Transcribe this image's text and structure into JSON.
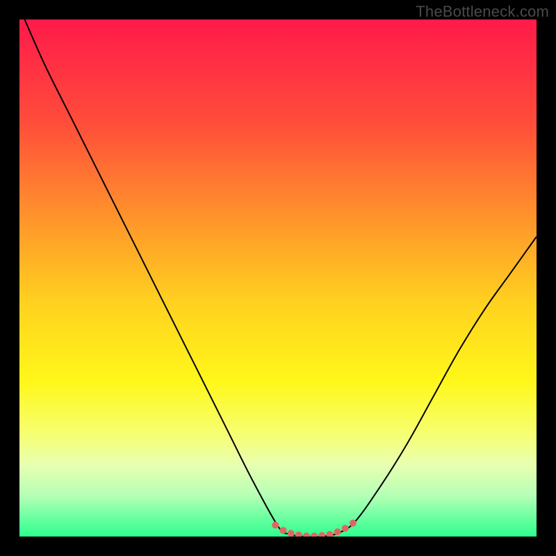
{
  "watermark": "TheBottleneck.com",
  "colors": {
    "frame": "#000000",
    "gradient_stops": [
      {
        "offset": 0.0,
        "color": "#ff1a4a"
      },
      {
        "offset": 0.2,
        "color": "#ff4d3a"
      },
      {
        "offset": 0.4,
        "color": "#ff9a2a"
      },
      {
        "offset": 0.55,
        "color": "#ffd21f"
      },
      {
        "offset": 0.7,
        "color": "#fff71a"
      },
      {
        "offset": 0.8,
        "color": "#f6ff70"
      },
      {
        "offset": 0.86,
        "color": "#e8ffb0"
      },
      {
        "offset": 0.92,
        "color": "#b6ffb6"
      },
      {
        "offset": 1.0,
        "color": "#2dff8f"
      }
    ],
    "curve": "#000000",
    "marker": "#e06666"
  },
  "chart_data": {
    "type": "line",
    "title": "",
    "xlabel": "",
    "ylabel": "",
    "xlim": [
      0,
      100
    ],
    "ylim": [
      0,
      100
    ],
    "series": [
      {
        "name": "bottleneck-curve",
        "x": [
          1,
          5,
          10,
          15,
          20,
          25,
          30,
          35,
          40,
          45,
          50,
          52,
          55,
          58,
          60,
          62,
          65,
          70,
          75,
          80,
          85,
          90,
          95,
          100
        ],
        "values": [
          100,
          91,
          81,
          71,
          61,
          51,
          41,
          31,
          21,
          11,
          2,
          0.5,
          0,
          0,
          0.2,
          0.8,
          3,
          10,
          18,
          27,
          36,
          44,
          51,
          58
        ]
      }
    ],
    "markers": {
      "name": "bottom-markers",
      "x": [
        49.5,
        51,
        52.5,
        54,
        55.5,
        57,
        58.5,
        60,
        61.5,
        63,
        64.5
      ],
      "values": [
        2.2,
        1.2,
        0.6,
        0.3,
        0.1,
        0.1,
        0.2,
        0.4,
        0.9,
        1.6,
        2.6
      ],
      "radius": 5
    }
  }
}
